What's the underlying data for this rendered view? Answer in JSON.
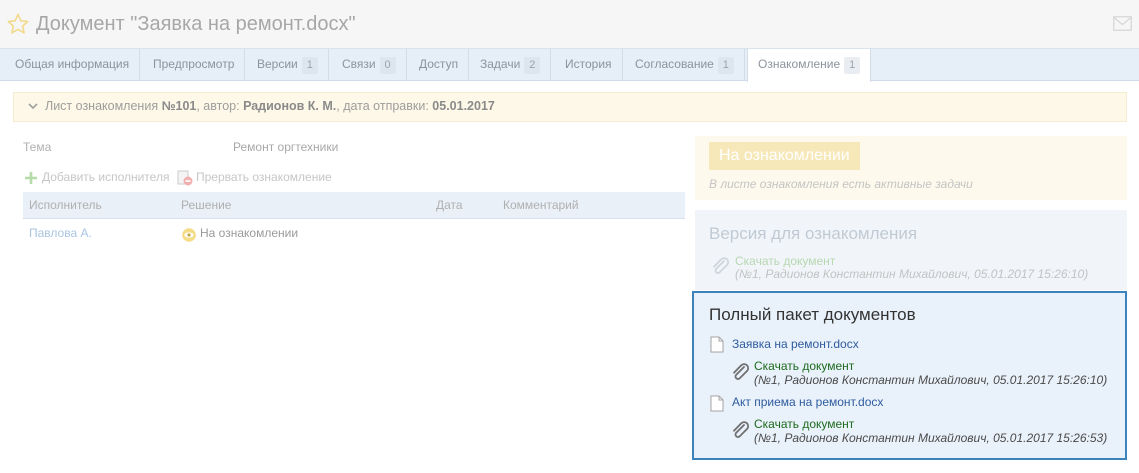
{
  "header": {
    "title": "Документ \"Заявка на ремонт.docx\"",
    "star_icon": "star-icon",
    "mail_icon": "envelope-icon"
  },
  "tabs": [
    {
      "label": "Общая информация",
      "count": ""
    },
    {
      "label": "Предпросмотр",
      "count": ""
    },
    {
      "label": "Версии",
      "count": "1"
    },
    {
      "label": "Связи",
      "count": "0"
    },
    {
      "label": "Доступ",
      "count": ""
    },
    {
      "label": "Задачи",
      "count": "2"
    },
    {
      "label": "История",
      "count": ""
    },
    {
      "label": "Согласование",
      "count": "1"
    },
    {
      "label": "Ознакомление",
      "count": "1",
      "active": true
    }
  ],
  "sheet": {
    "prefix": "Лист ознакомления ",
    "number": "№101",
    "author_label": ", автор: ",
    "author": "Радионов К. М.",
    "date_label": ", дата отправки: ",
    "date": "05.01.2017"
  },
  "left": {
    "topic_label": "Тема",
    "topic_value": "Ремонт оргтехники",
    "add_executor": "Добавить исполнителя",
    "stop_review": "Прервать ознакомление",
    "columns": [
      "Исполнитель",
      "Решение",
      "Дата",
      "Комментарий"
    ],
    "rows": [
      {
        "executor": "Павлова А.",
        "decision": "На ознакомлении",
        "date": "",
        "comment": ""
      }
    ]
  },
  "status": {
    "label": "На ознакомлении",
    "note": "В листе ознакомления есть активные задачи"
  },
  "version": {
    "title": "Версия для ознакомления",
    "download": "Скачать документ",
    "meta": "(№1, Радионов Константин Михайлович, 05.01.2017 15:26:10)"
  },
  "package": {
    "title": "Полный пакет документов",
    "files": [
      {
        "name": "Заявка на ремонт.docx",
        "download": "Скачать документ",
        "meta": "(№1, Радионов Константин Михайлович, 05.01.2017 15:26:10)"
      },
      {
        "name": "Акт приема на ремонт.docx",
        "download": "Скачать документ",
        "meta": "(№1, Радионов Константин Михайлович, 05.01.2017 15:26:53)"
      }
    ]
  },
  "colors": {
    "accent_blue": "#3b83bd",
    "link_blue": "#2f5c9e",
    "download_green": "#1e6b1e",
    "status_yellow": "#f6e8b8"
  }
}
